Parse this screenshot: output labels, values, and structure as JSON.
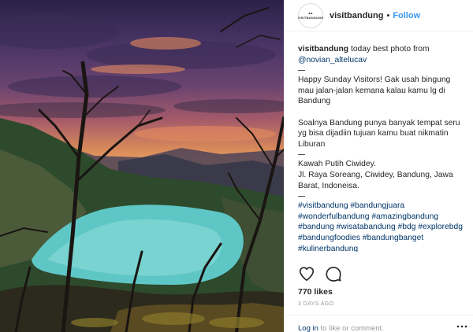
{
  "post": {
    "username": "visitbandung",
    "follow_label": "Follow",
    "separator": "•",
    "avatar_text": "VISITBANDUNG",
    "caption": {
      "intro": "today best photo from",
      "credit": "@novian_altelucav",
      "p1": "Happy Sunday Visitors! Gak usah bingung mau jalan-jalan kemana kalau kamu lg di Bandung",
      "p2": "Soalnya Bandung punya banyak tempat seru yg bisa dijadiin tujuan kamu buat nikmatin Liburan",
      "place": "Kawah Putih Ciwidey.",
      "address": "Jl. Raya Soreang, Ciwidey, Bandung, Jawa Barat, Indoneisa.",
      "hashtags": "#visitbandung #bandungjuara #wonderfulbandung #amazingbandung #bandung #wisatabandung #bdg #explorebdg #bandungfoodies #bandungbanget #kulinerbandung"
    },
    "likes": "770 likes",
    "time_ago": "3 DAYS AGO",
    "comment": {
      "login_label": "Log in",
      "rest": " to like or comment."
    }
  },
  "icons": {
    "like": "heart-icon",
    "comment": "comment-bubble-icon",
    "more": "more-options-icon"
  },
  "colors": {
    "follow": "#3897f0",
    "link": "#003569",
    "muted": "#999999"
  }
}
